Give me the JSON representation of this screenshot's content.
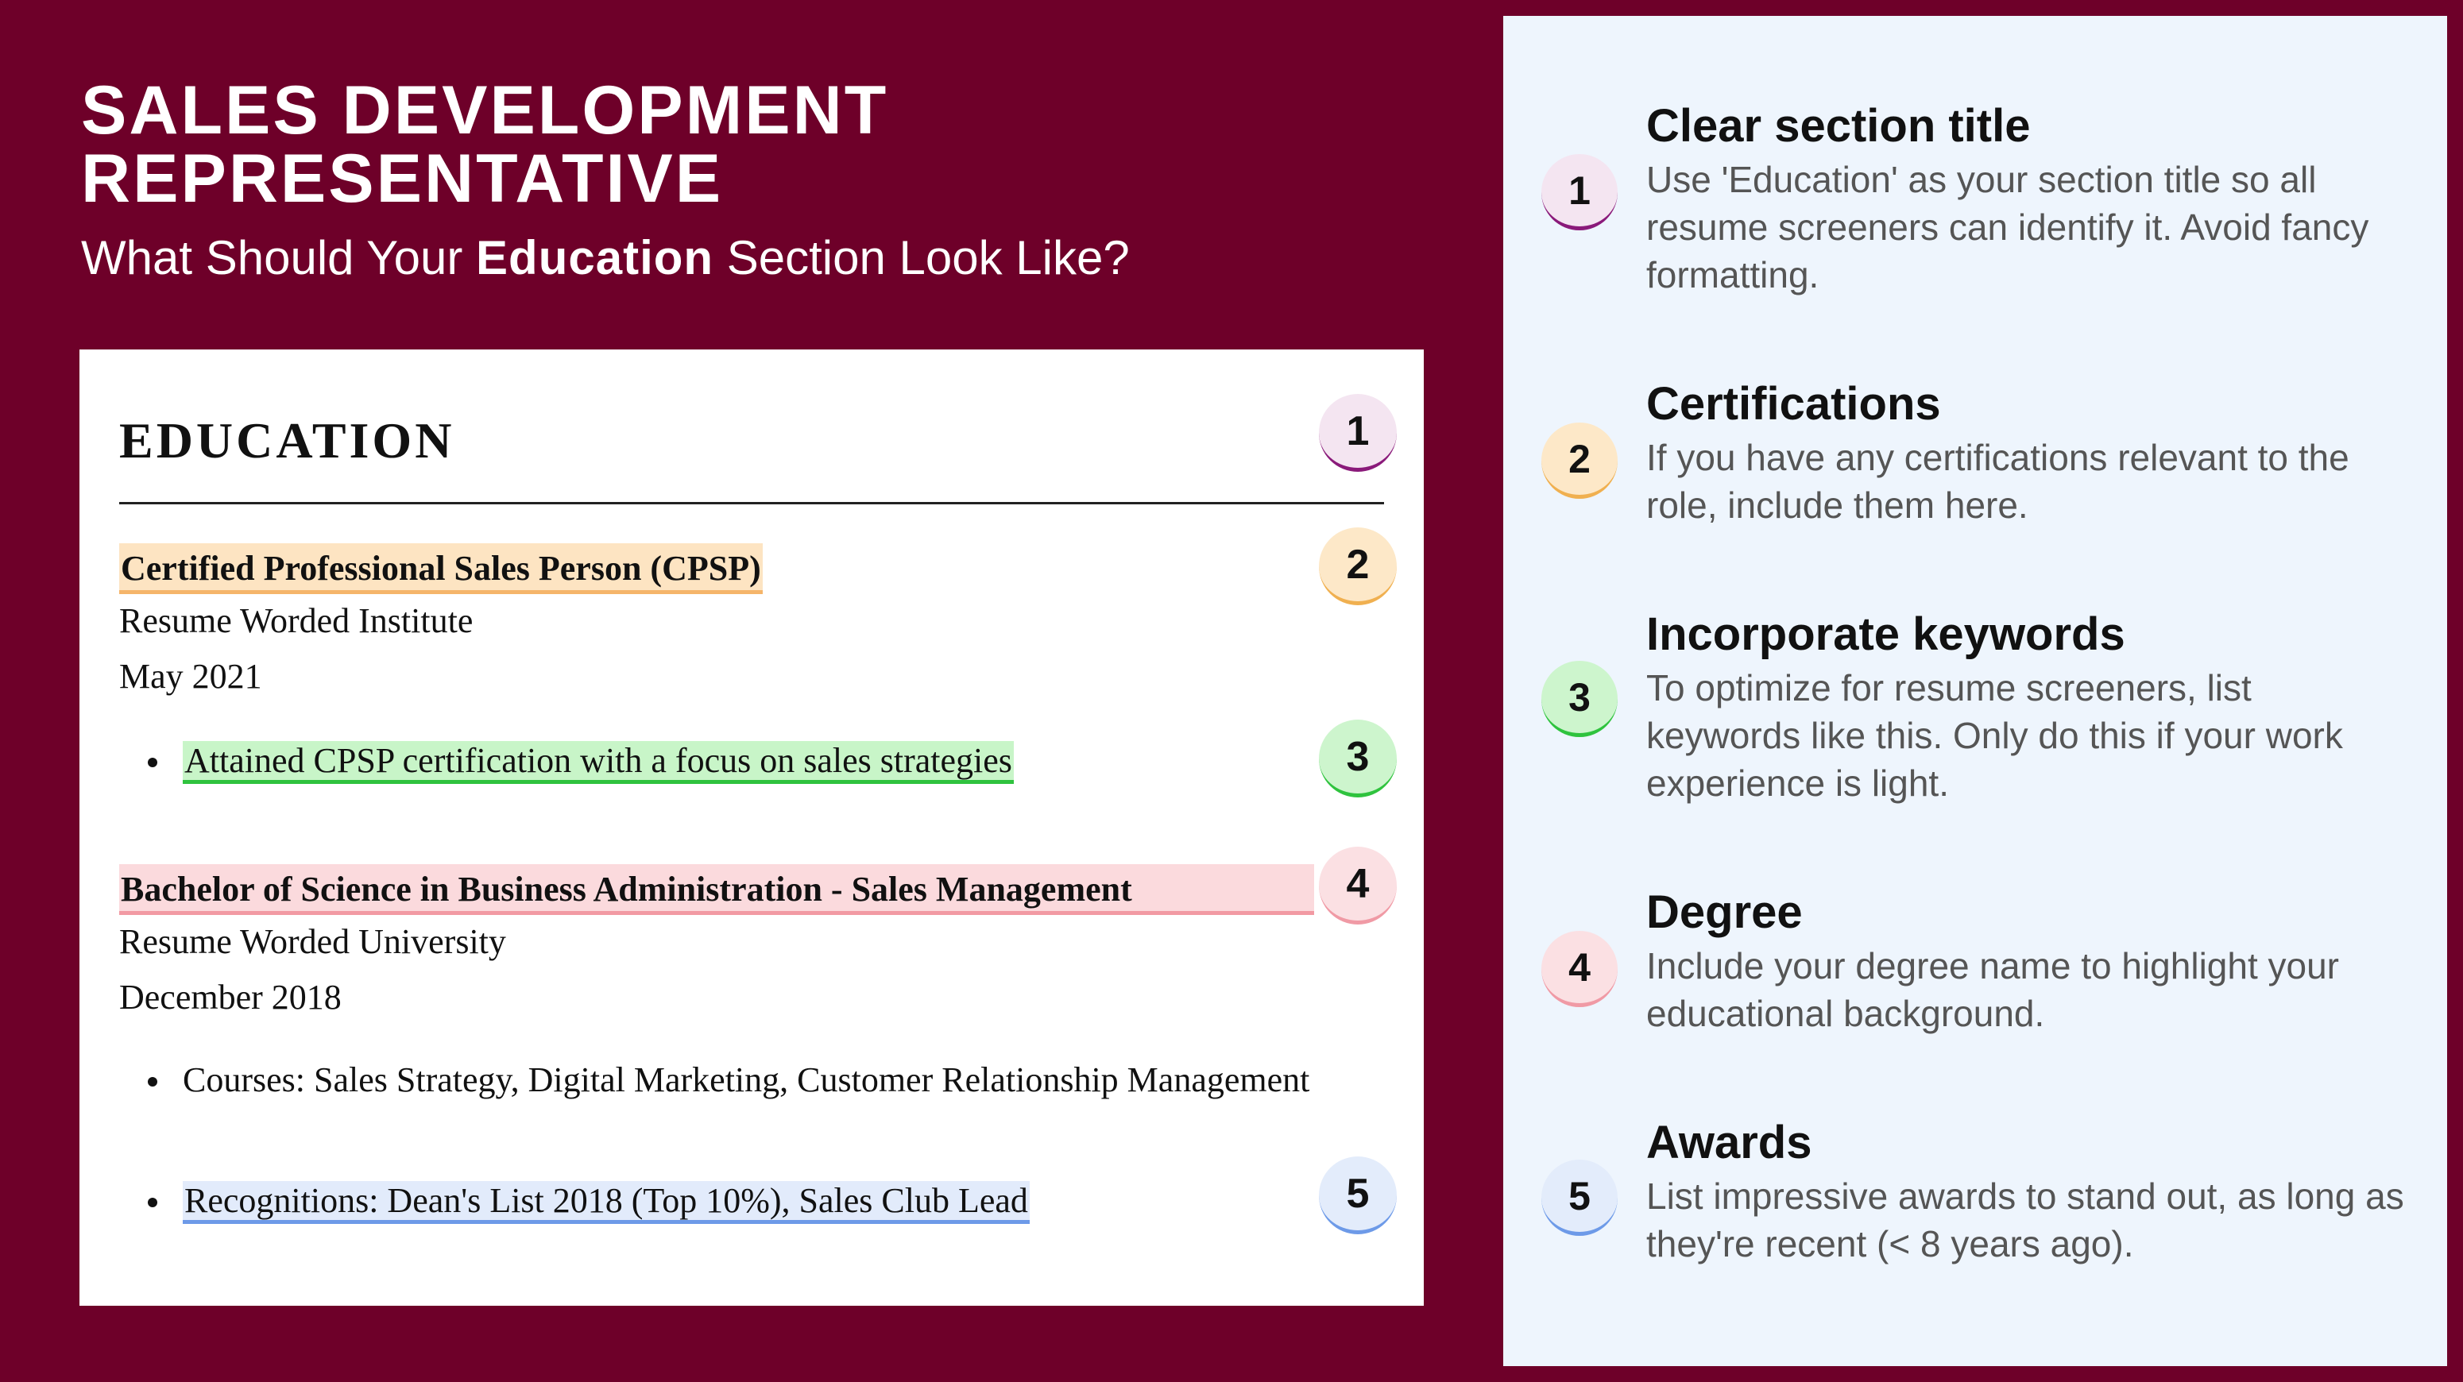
{
  "header": {
    "title_line1": "SALES DEVELOPMENT",
    "title_line2": "REPRESENTATIVE",
    "subtitle_pre": "What Should Your ",
    "subtitle_bold": "Education",
    "subtitle_post": " Section Look Like?"
  },
  "resume": {
    "section_title": "EDUCATION",
    "entries": [
      {
        "title": "Certified Professional Sales Person (CPSP)",
        "institution": "Resume Worded Institute",
        "date": "May 2021",
        "bullets": [
          "Attained CPSP certification with a focus on sales strategies"
        ]
      },
      {
        "title": "Bachelor of Science in Business Administration - Sales Management",
        "institution": "Resume Worded University",
        "date": "December 2018",
        "bullets": [
          "Courses: Sales Strategy, Digital Marketing, Customer Relationship Management",
          "Recognitions: Dean's List 2018 (Top 10%), Sales Club Lead"
        ]
      }
    ],
    "badges": [
      "1",
      "2",
      "3",
      "4",
      "5"
    ]
  },
  "tips": [
    {
      "number": "1",
      "title": "Clear section title",
      "description": "Use 'Education' as your section title so all resume screeners can identify it. Avoid fancy formatting."
    },
    {
      "number": "2",
      "title": "Certifications",
      "description": "If you have any certifications relevant to the role, include them here."
    },
    {
      "number": "3",
      "title": "Incorporate keywords",
      "description": "To optimize for resume screeners, list keywords like this. Only do this if your work experience is light."
    },
    {
      "number": "4",
      "title": "Degree",
      "description": "Include your degree name to highlight your educational background."
    },
    {
      "number": "5",
      "title": "Awards",
      "description": "List impressive awards to stand out, as long as they're recent (< 8 years ago)."
    }
  ],
  "colors": {
    "background": "#6e0029",
    "panel": "#eef5fd",
    "highlight_1": "#8a1a7a",
    "highlight_2": "#f0b050",
    "highlight_3": "#2fc33e",
    "highlight_4": "#f09aa5",
    "highlight_5": "#6d9ae8"
  }
}
